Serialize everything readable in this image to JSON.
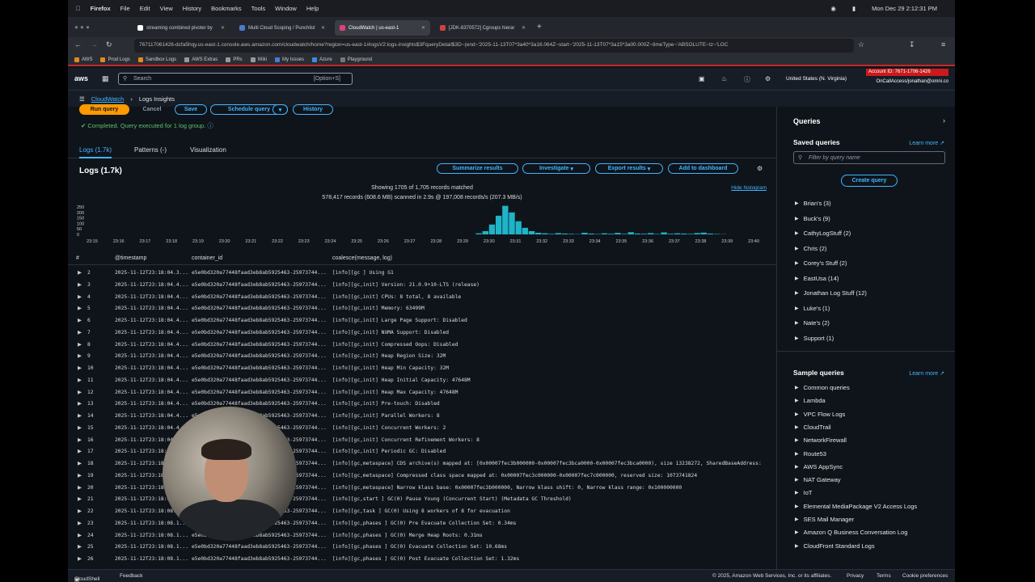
{
  "menubar": {
    "app": "Firefox",
    "items": [
      "File",
      "Edit",
      "View",
      "History",
      "Bookmarks",
      "Tools",
      "Window",
      "Help"
    ],
    "datetime": "Mon Dec 29  2:12:31 PM"
  },
  "tabs": [
    {
      "label": "streaming combined pivoter by",
      "color": "#ffffff"
    },
    {
      "label": "Multi Cloud Scoping / Punchlist",
      "color": "#4a7bd0"
    },
    {
      "label": "CloudWatch | us-east-1",
      "color": "#e0417a"
    },
    {
      "label": "[JDK-8370572] Cgroups hierar",
      "color": "#d04040"
    }
  ],
  "url": "767117061426-dcfa5hqy.us-east-1.console.aws.amazon.com/cloudwatch/home?region=us-east-1#logsV2:logs-insights$3FqueryDetail$3D~(end~'2025-11-13T07*3a40*3a16.064Z~start~'2025-11-13T07*3a15*3a00.000Z~timeType~'ABSOLUTE~tz~'LOC",
  "bookmarks": [
    "AWS",
    "Prod Logs",
    "Sandbox Logs",
    "AWS Extras",
    "PRs",
    "Wiki",
    "My Issues",
    "Azure",
    "Playground"
  ],
  "aws": {
    "logo": "aws",
    "search_placeholder": "Search",
    "search_hint": "[Option+S]",
    "region": "United States (N. Virginia)",
    "account": "Account ID: 7671-1706-1426",
    "user": "OnCallAccess/jonathan@omni.co"
  },
  "breadcrumb": {
    "service": "CloudWatch",
    "page": "Logs Insights"
  },
  "actions": {
    "run": "Run query",
    "cancel": "Cancel",
    "save": "Save",
    "schedule": "Schedule query",
    "history": "History",
    "status": "Completed. Query executed for 1 log group."
  },
  "result_tabs": [
    "Logs (1.7k)",
    "Patterns (-)",
    "Visualization"
  ],
  "logs": {
    "title": "Logs (1.7k)",
    "summarize": "Summarize results",
    "investigate": "Investigate",
    "export": "Export results",
    "dashboard": "Add to dashboard",
    "showing": "Showing 1705 of 1,705 records matched",
    "scanned": "578,417 records (608.6 MB) scanned in 2.9s @ 197,008 records/s (207.3 MB/s)",
    "hide_histogram": "Hide histogram"
  },
  "histogram": {
    "y_ticks": [
      "250",
      "200",
      "150",
      "100",
      "50",
      "0"
    ],
    "x_ticks": [
      "23:15",
      "23:16",
      "23:17",
      "23:18",
      "23:19",
      "23:20",
      "23:21",
      "23:22",
      "23:23",
      "23:24",
      "23:25",
      "23:26",
      "23:27",
      "23:28",
      "23:29",
      "23:30",
      "23:31",
      "23:32",
      "23:33",
      "23:34",
      "23:35",
      "23:36",
      "23:37",
      "23:38",
      "23:39",
      "23:40"
    ],
    "bars": [
      0,
      0,
      0,
      0,
      0,
      0,
      0,
      0,
      0,
      0,
      0,
      0,
      0,
      0,
      0,
      0,
      0,
      0,
      0,
      0,
      0,
      0,
      0,
      0,
      0,
      0,
      0,
      0,
      0,
      0,
      0,
      0,
      0,
      0,
      0,
      0,
      0,
      0,
      0,
      0,
      0,
      0,
      0,
      0,
      0,
      0,
      0,
      0,
      0,
      0,
      0,
      0,
      0,
      0,
      0,
      0,
      0,
      0,
      10,
      30,
      90,
      170,
      260,
      200,
      120,
      60,
      30,
      15,
      10,
      5,
      12,
      8,
      5,
      3,
      15,
      8,
      4,
      10,
      6,
      14,
      5,
      20,
      8,
      6,
      12,
      4,
      18,
      6,
      10,
      8,
      5,
      12,
      16,
      8,
      4,
      2,
      0,
      0
    ]
  },
  "table": {
    "headers": [
      "#",
      "@timestamp",
      "container_id",
      "coalesce(message, log)"
    ],
    "rows": [
      {
        "n": "2",
        "ts": "2025-11-12T23:18:04.3...",
        "cid": "e5e0bd320a77448faad3eb8ab5925463-25973744...",
        "msg": "[info][gc ] Using G1"
      },
      {
        "n": "3",
        "ts": "2025-11-12T23:18:04.4...",
        "cid": "e5e0bd320a77448faad3eb8ab5925463-25973744...",
        "msg": "[info][gc,init] Version: 21.0.9+10-LTS (release)"
      },
      {
        "n": "4",
        "ts": "2025-11-12T23:18:04.4...",
        "cid": "e5e0bd320a77448faad3eb8ab5925463-25973744...",
        "msg": "[info][gc,init] CPUs: 8 total, 8 available"
      },
      {
        "n": "5",
        "ts": "2025-11-12T23:18:04.4...",
        "cid": "e5e0bd320a77448faad3eb8ab5925463-25973744...",
        "msg": "[info][gc,init] Memory: 63499M"
      },
      {
        "n": "6",
        "ts": "2025-11-12T23:18:04.4...",
        "cid": "e5e0bd320a77448faad3eb8ab5925463-25973744...",
        "msg": "[info][gc,init] Large Page Support: Disabled"
      },
      {
        "n": "7",
        "ts": "2025-11-12T23:18:04.4...",
        "cid": "e5e0bd320a77448faad3eb8ab5925463-25973744...",
        "msg": "[info][gc,init] NUMA Support: Disabled"
      },
      {
        "n": "8",
        "ts": "2025-11-12T23:18:04.4...",
        "cid": "e5e0bd320a77448faad3eb8ab5925463-25973744...",
        "msg": "[info][gc,init] Compressed Oops: Disabled"
      },
      {
        "n": "9",
        "ts": "2025-11-12T23:18:04.4...",
        "cid": "e5e0bd320a77448faad3eb8ab5925463-25973744...",
        "msg": "[info][gc,init] Heap Region Size: 32M"
      },
      {
        "n": "10",
        "ts": "2025-11-12T23:18:04.4...",
        "cid": "e5e0bd320a77448faad3eb8ab5925463-25973744...",
        "msg": "[info][gc,init] Heap Min Capacity: 32M"
      },
      {
        "n": "11",
        "ts": "2025-11-12T23:18:04.4...",
        "cid": "e5e0bd320a77448faad3eb8ab5925463-25973744...",
        "msg": "[info][gc,init] Heap Initial Capacity: 47648M"
      },
      {
        "n": "12",
        "ts": "2025-11-12T23:18:04.4...",
        "cid": "e5e0bd320a77448faad3eb8ab5925463-25973744...",
        "msg": "[info][gc,init] Heap Max Capacity: 47648M"
      },
      {
        "n": "13",
        "ts": "2025-11-12T23:18:04.4...",
        "cid": "e5e0bd320a77448faad3eb8ab5925463-25973744...",
        "msg": "[info][gc,init] Pre-touch: Disabled"
      },
      {
        "n": "14",
        "ts": "2025-11-12T23:18:04.4...",
        "cid": "e5e0bd320a77448faad3eb8ab5925463-25973744...",
        "msg": "[info][gc,init] Parallel Workers: 8"
      },
      {
        "n": "15",
        "ts": "2025-11-12T23:18:04.4...",
        "cid": "e5e0bd320a77448faad3eb8ab5925463-25973744...",
        "msg": "[info][gc,init] Concurrent Workers: 2"
      },
      {
        "n": "16",
        "ts": "2025-11-12T23:18:04.4...",
        "cid": "e5e0bd320a77448faad3eb8ab5925463-25973744...",
        "msg": "[info][gc,init] Concurrent Refinement Workers: 8"
      },
      {
        "n": "17",
        "ts": "2025-11-12T23:18:04.4...",
        "cid": "e5e0bd320a77448faad3eb8ab5925463-25973744...",
        "msg": "[info][gc,init] Periodic GC: Disabled"
      },
      {
        "n": "18",
        "ts": "2025-11-12T23:18:04.4...",
        "cid": "e5e0bd320a77448faad3eb8ab5925463-25973744...",
        "msg": "[info][gc,metaspace] CDS archive(s) mapped at: [0x00007fec3b000000-0x00007fec3bca0000-0x00007fec3bca0000), size 13238272, SharedBaseAddress:"
      },
      {
        "n": "19",
        "ts": "2025-11-12T23:18:04.4...",
        "cid": "e5e0bd320a77448faad3eb8ab5925463-25973744...",
        "msg": "[info][gc,metaspace] Compressed class space mapped at: 0x00007fec3c000000-0x00007fec7c000000, reserved size: 1073741824"
      },
      {
        "n": "20",
        "ts": "2025-11-12T23:18:04.4...",
        "cid": "e5e0bd320a77448faad3eb8ab5925463-25973744...",
        "msg": "[info][gc,metaspace] Narrow klass base: 0x00007fec3b000000, Narrow klass shift: 0, Narrow klass range: 0x100000000"
      },
      {
        "n": "21",
        "ts": "2025-11-12T23:18:08.1...",
        "cid": "e5e0bd320a77448faad3eb8ab5925463-25973744...",
        "msg": "[info][gc,start ] GC(0) Pause Young (Concurrent Start) (Metadata GC Threshold)"
      },
      {
        "n": "22",
        "ts": "2025-11-12T23:18:08.1...",
        "cid": "e5e0bd320a77448faad3eb8ab5925463-25973744...",
        "msg": "[info][gc,task ] GC(0) Using 8 workers of 8 for evacuation"
      },
      {
        "n": "23",
        "ts": "2025-11-12T23:18:08.1...",
        "cid": "e5e0bd320a77448faad3eb8ab5925463-25973744...",
        "msg": "[info][gc,phases ] GC(0) Pre Evacuate Collection Set: 0.34ms"
      },
      {
        "n": "24",
        "ts": "2025-11-12T23:18:08.1...",
        "cid": "e5e0bd320a77448faad3eb8ab5925463-25973744...",
        "msg": "[info][gc,phases ] GC(0) Merge Heap Roots: 0.31ms"
      },
      {
        "n": "25",
        "ts": "2025-11-12T23:18:08.1...",
        "cid": "e5e0bd320a77448faad3eb8ab5925463-25973744...",
        "msg": "[info][gc,phases ] GC(0) Evacuate Collection Set: 10.68ms"
      },
      {
        "n": "26",
        "ts": "2025-11-12T23:18:08.1...",
        "cid": "e5e0bd320a77448faad3eb8ab5925463-25973744...",
        "msg": "[info][gc,phases ] GC(0) Post Evacuate Collection Set: 1.32ms"
      }
    ]
  },
  "queries_panel": {
    "title": "Queries",
    "saved_title": "Saved queries",
    "learn_more": "Learn more",
    "filter_placeholder": "Filter by query name",
    "create": "Create query",
    "saved": [
      "Brian's (3)",
      "Buck's (9)",
      "CathyLogStuff (2)",
      "Chris (2)",
      "Corey's Stuff (2)",
      "EastUsa (14)",
      "Jonathan Log Stuff (12)",
      "Luke's (1)",
      "Nate's (2)",
      "Support (1)"
    ],
    "sample_title": "Sample queries",
    "samples": [
      "Common queries",
      "Lambda",
      "VPC Flow Logs",
      "CloudTrail",
      "NetworkFirewall",
      "Route53",
      "AWS AppSync",
      "NAT Gateway",
      "IoT",
      "Elemental MediaPackage V2 Access Logs",
      "SES Mail Manager",
      "Amazon Q Business Conversation Log",
      "CloudFront Standard Logs"
    ]
  },
  "footer": {
    "cloudshell": "CloudShell",
    "feedback": "Feedback",
    "copyright": "© 2025, Amazon Web Services, Inc. or its affiliates.",
    "privacy": "Privacy",
    "terms": "Terms",
    "cookies": "Cookie preferences"
  },
  "colors": {
    "accent": "#42b4ff",
    "run": "#ff9900",
    "bar": "#1fb4c8",
    "account": "#c91b1b"
  }
}
